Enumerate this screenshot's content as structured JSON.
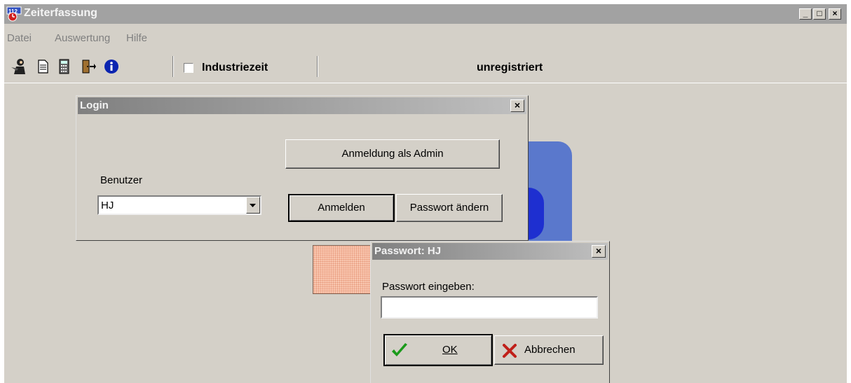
{
  "window": {
    "title": "Zeiterfassung",
    "controls": {
      "minimize": "_",
      "maximize": "□",
      "close": "×"
    }
  },
  "menu": {
    "items": [
      "Datei",
      "Auswertung",
      "Hilfe"
    ]
  },
  "toolbar": {
    "icons": [
      "user-login-icon",
      "document-icon",
      "calculator-icon",
      "exit-door-icon",
      "info-icon"
    ],
    "industriezeit_label": "Industriezeit",
    "industriezeit_checked": false,
    "status": "unregistriert"
  },
  "login_dialog": {
    "title": "Login",
    "admin_button": "Anmeldung als Admin",
    "user_label": "Benutzer",
    "user_value": "HJ",
    "login_button": "Anmelden",
    "change_password_button": "Passwort ändern",
    "close": "×"
  },
  "password_dialog": {
    "title": "Passwort: HJ",
    "prompt": "Passwort eingeben:",
    "password_value": "",
    "ok_button": "OK",
    "cancel_button": "Abbrechen",
    "close": "×"
  },
  "colors": {
    "window_bg": "#d4d0c8",
    "titlebar_inactive": "#a2a2a2",
    "ok_check": "#1a9a1a",
    "cancel_x": "#c0201a"
  }
}
